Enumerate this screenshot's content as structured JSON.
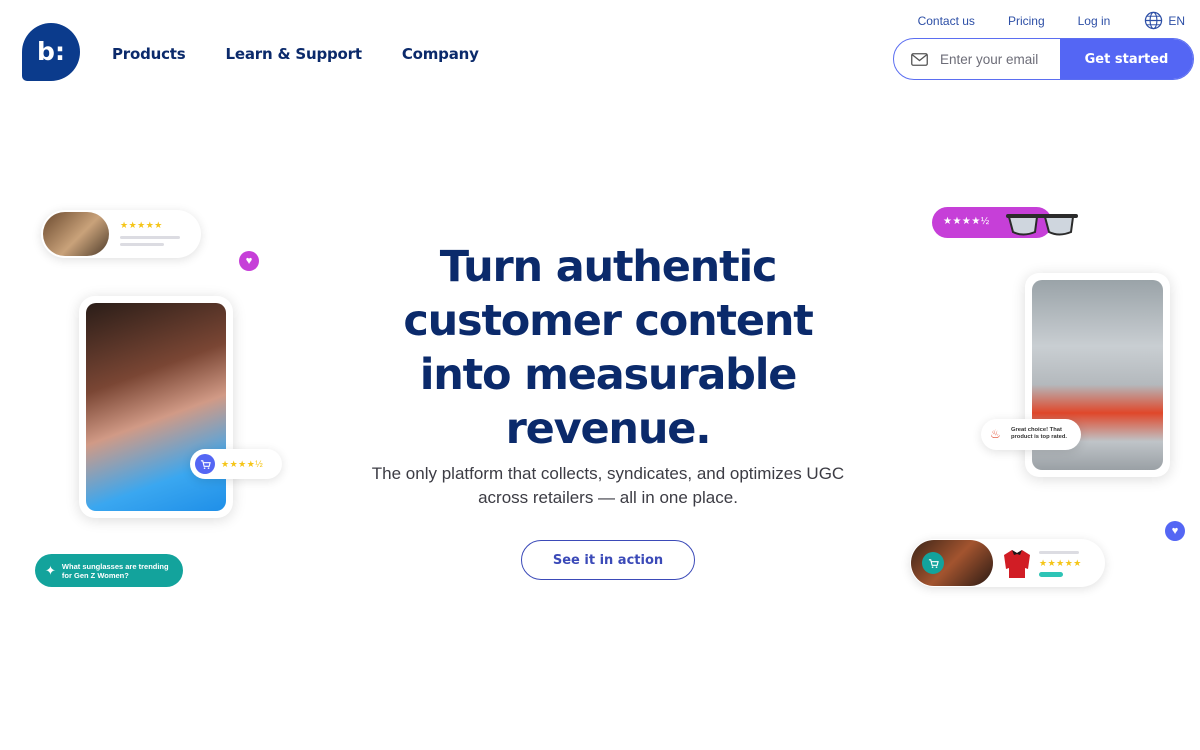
{
  "brand": {
    "logo_glyph": "b:",
    "logo_color": "#0b3b8c"
  },
  "nav": {
    "main": [
      "Products",
      "Learn & Support",
      "Company"
    ],
    "utility": [
      "Contact us",
      "Pricing",
      "Log in"
    ],
    "language": "EN"
  },
  "signup": {
    "placeholder": "Enter your email",
    "button": "Get started"
  },
  "hero": {
    "title": "Turn authentic customer content into measurable revenue.",
    "subtitle": "The only platform that collects, syndicates, and optimizes UGC across retailers — all in one place.",
    "cta": "See it in action"
  },
  "decor": {
    "ai_prompt": "What sunglasses are trending for Gen Z Women?",
    "top_rated_note": "Great choice! That product is top rated.",
    "stars_5": "★★★★★",
    "stars_45": "★★★★½"
  },
  "colors": {
    "accent": "#5466f4",
    "navy": "#0b2a6b",
    "magenta": "#c63fd8",
    "teal": "#13a39c"
  }
}
